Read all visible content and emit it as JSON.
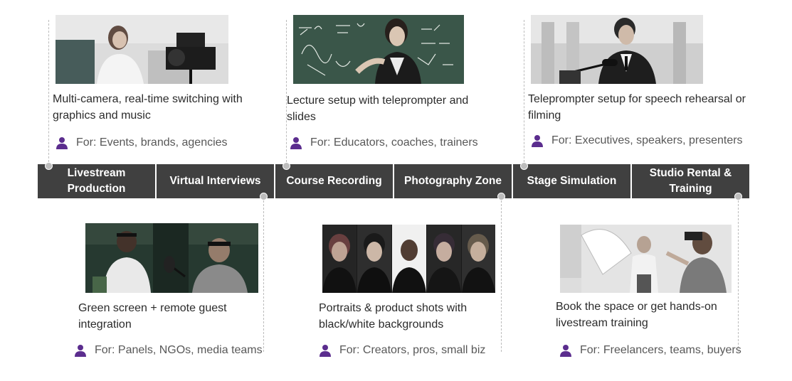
{
  "colors": {
    "nav_bg": "#404040",
    "nav_text": "#ffffff",
    "icon_purple": "#5b2d8e",
    "connector_gray": "#bdbdbd"
  },
  "nav": {
    "items": [
      {
        "label": "Livestream\nProduction"
      },
      {
        "label": "Virtual Interviews"
      },
      {
        "label": "Course Recording"
      },
      {
        "label": "Photography Zone"
      },
      {
        "label": "Stage Simulation"
      },
      {
        "label": "Studio Rental &\nTraining"
      }
    ]
  },
  "cards": [
    {
      "photo_alt": "woman-at-livestream-camera-photo",
      "description": "Multi-camera, real-time switching with graphics and music",
      "audience": "For: Events, brands, agencies",
      "icon": "person-icon"
    },
    {
      "photo_alt": "teacher-at-chalkboard-photo",
      "description": "Lecture setup with teleprompter and slides",
      "audience": "For: Educators, coaches, trainers",
      "icon": "person-icon"
    },
    {
      "photo_alt": "speaker-at-podium-photo",
      "description": "Teleprompter setup for speech rehearsal or filming",
      "audience": "For: Executives, speakers, presenters",
      "icon": "person-icon"
    },
    {
      "photo_alt": "podcast-interview-photo",
      "description": "Green screen + remote guest integration",
      "audience": "For: Panels, NGOs, media teams",
      "icon": "person-icon"
    },
    {
      "photo_alt": "portrait-grid-photo",
      "description": "Portraits & product shots with black/white backgrounds",
      "audience": "For: Creators, pros, small biz",
      "icon": "person-icon"
    },
    {
      "photo_alt": "studio-photoshoot-photo",
      "description": "Book the space or get hands-on livestream training",
      "audience": "For: Freelancers, teams, buyers",
      "icon": "person-icon"
    }
  ]
}
